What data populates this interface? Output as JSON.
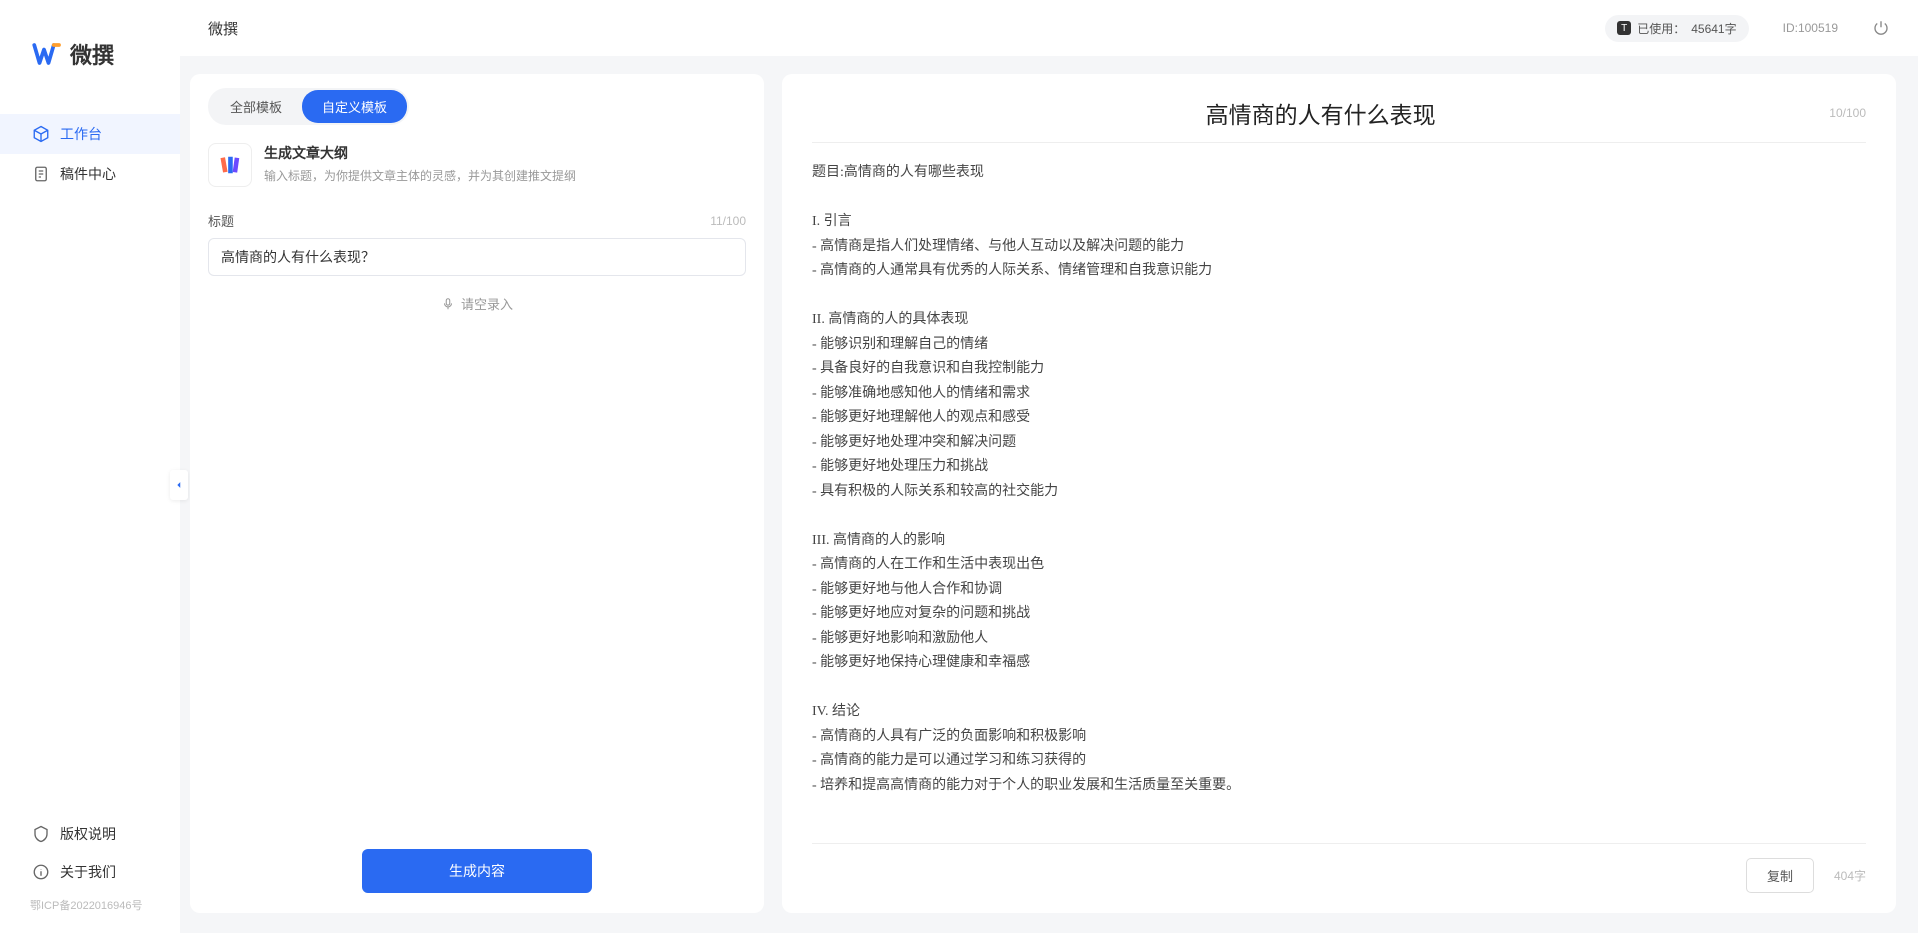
{
  "app": {
    "brand_text": "微撰",
    "topbar_title": "微撰",
    "usage_label": "已使用：",
    "usage_value": "45641字",
    "user_id_label": "ID:",
    "user_id_value": "100519"
  },
  "sidebar": {
    "nav": [
      {
        "label": "工作台",
        "active": true
      },
      {
        "label": "稿件中心",
        "active": false
      }
    ],
    "bottom": [
      {
        "label": "版权说明"
      },
      {
        "label": "关于我们"
      }
    ],
    "icp": "鄂ICP备2022016946号"
  },
  "left_panel": {
    "tabs": [
      {
        "label": "全部模板",
        "active": false
      },
      {
        "label": "自定义模板",
        "active": true
      }
    ],
    "template": {
      "title": "生成文章大纲",
      "desc": "输入标题，为你提供文章主体的灵感，并为其创建推文提纲"
    },
    "field": {
      "label": "标题",
      "counter": "11/100",
      "value": "高情商的人有什么表现？"
    },
    "voice_hint": "请空录入",
    "generate_btn": "生成内容"
  },
  "output": {
    "title": "高情商的人有什么表现",
    "title_counter": "10/100",
    "body": "题目:高情商的人有哪些表现\n\nI. 引言\n- 高情商是指人们处理情绪、与他人互动以及解决问题的能力\n- 高情商的人通常具有优秀的人际关系、情绪管理和自我意识能力\n\nII. 高情商的人的具体表现\n- 能够识别和理解自己的情绪\n- 具备良好的自我意识和自我控制能力\n- 能够准确地感知他人的情绪和需求\n- 能够更好地理解他人的观点和感受\n- 能够更好地处理冲突和解决问题\n- 能够更好地处理压力和挑战\n- 具有积极的人际关系和较高的社交能力\n\nIII. 高情商的人的影响\n- 高情商的人在工作和生活中表现出色\n- 能够更好地与他人合作和协调\n- 能够更好地应对复杂的问题和挑战\n- 能够更好地影响和激励他人\n- 能够更好地保持心理健康和幸福感\n\nIV. 结论\n- 高情商的人具有广泛的负面影响和积极影响\n- 高情商的能力是可以通过学习和练习获得的\n- 培养和提高高情商的能力对于个人的职业发展和生活质量至关重要。",
    "copy_btn": "复制",
    "word_count": "404字"
  }
}
